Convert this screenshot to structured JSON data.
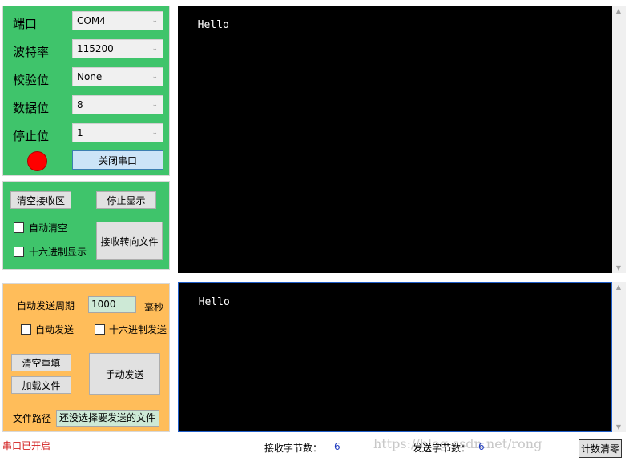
{
  "serial": {
    "port_label": "端口",
    "port_value": "COM4",
    "baud_label": "波特率",
    "baud_value": "115200",
    "parity_label": "校验位",
    "parity_value": "None",
    "databits_label": "数据位",
    "databits_value": "8",
    "stopbits_label": "停止位",
    "stopbits_value": "1",
    "toggle_label": "关闭串口",
    "status_color": "#ff0000"
  },
  "receive": {
    "clear_label": "清空接收区",
    "stop_label": "停止显示",
    "auto_clear_label": "自动清空",
    "hex_display_label": "十六进制显示",
    "to_file_label": "接收转向文件",
    "text": "Hello"
  },
  "send": {
    "period_label": "自动发送周期",
    "period_value": "1000",
    "unit_label": "毫秒",
    "auto_send_label": "自动发送",
    "hex_send_label": "十六进制发送",
    "clear_label": "清空重填",
    "load_label": "加载文件",
    "manual_label": "手动发送",
    "path_label": "文件路径",
    "path_value": "还没选择要发送的文件",
    "text": "Hello"
  },
  "status": {
    "port_status": "串口已开启",
    "rx_label": "接收字节数：",
    "rx_value": "6",
    "tx_label": "发送字节数：",
    "tx_value": "6",
    "reset_label": "计数清零",
    "watermark": "https://blog.csdn.net/rong"
  },
  "colors": {
    "green_panel": "#3fc46b",
    "orange_panel": "#ffbd5a",
    "terminal_bg": "#000000"
  }
}
